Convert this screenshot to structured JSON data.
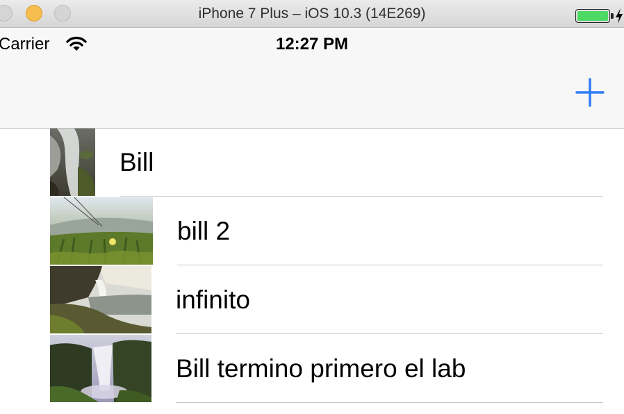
{
  "window": {
    "title": "iPhone 7 Plus – iOS 10.3 (14E269)"
  },
  "status_bar": {
    "carrier": "Carrier",
    "time": "12:27 PM",
    "battery_color": "#4cd964"
  },
  "nav_bar": {
    "add_icon": "plus-icon",
    "accent_color": "#2d7cf6"
  },
  "rows": [
    {
      "label": "Bill",
      "image": "waterfall-rocks-photo"
    },
    {
      "label": "bill 2",
      "image": "meadow-flower-photo"
    },
    {
      "label": "infinito",
      "image": "coastal-waterfall-photo"
    },
    {
      "label": "Bill termino primero el lab",
      "image": "canyon-waterfall-photo"
    }
  ]
}
